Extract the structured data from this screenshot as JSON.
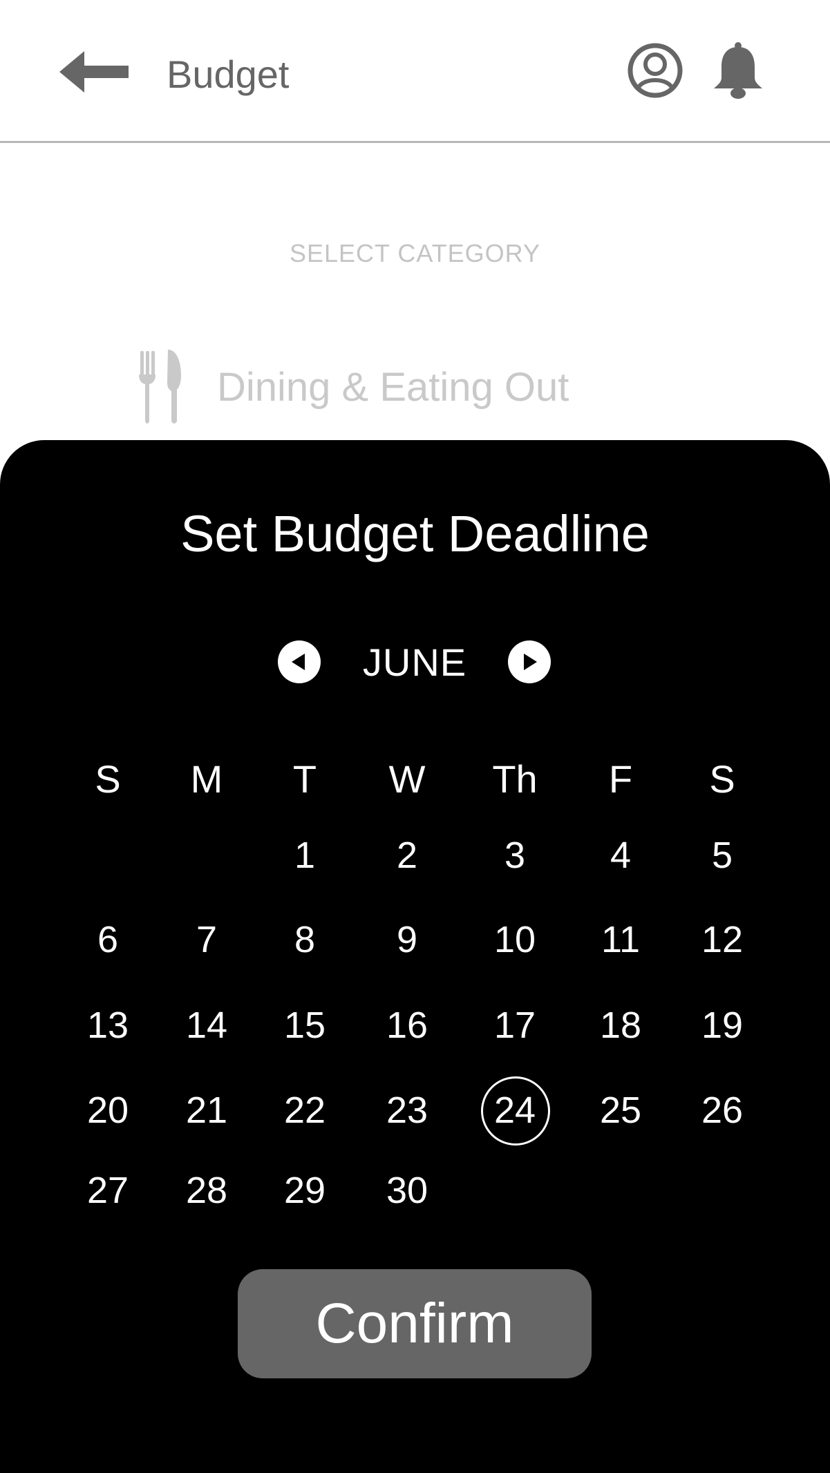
{
  "header": {
    "title": "Budget",
    "back_icon": "arrow-left-icon",
    "profile_icon": "user-circle-icon",
    "notification_icon": "bell-icon"
  },
  "category": {
    "heading": "SELECT CATEGORY",
    "selected": {
      "icon": "fork-knife-icon",
      "label": "Dining & Eating Out"
    }
  },
  "deadline_modal": {
    "title": "Set Budget Deadline",
    "month": "JUNE",
    "prev_icon": "chevron-left-circle-icon",
    "next_icon": "chevron-right-circle-icon",
    "weekdays": [
      "S",
      "M",
      "T",
      "W",
      "Th",
      "F",
      "S"
    ],
    "first_weekday_index": 2,
    "days_in_month": 30,
    "selected_day": 24,
    "confirm_label": "Confirm"
  },
  "colors": {
    "header_text": "#666666",
    "muted_text": "#c4c4c4",
    "modal_background": "#000000",
    "modal_text": "#ffffff",
    "confirm_button": "#666666"
  }
}
